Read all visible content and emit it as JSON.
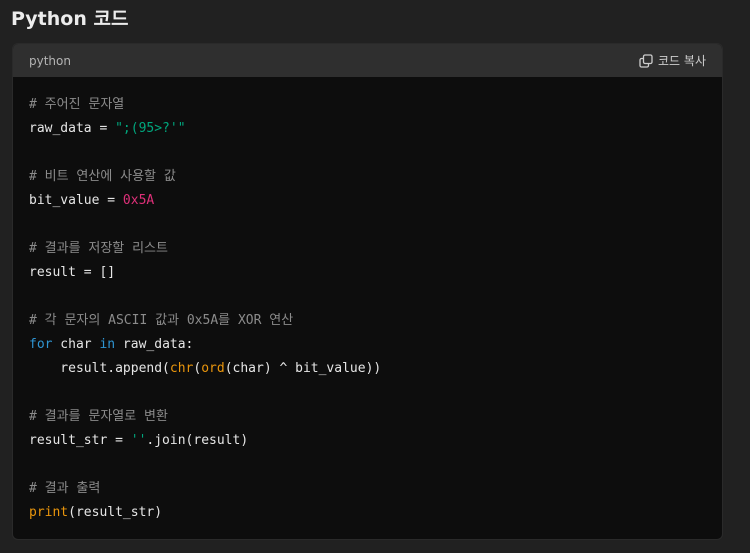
{
  "heading": "Python 코드",
  "code_block": {
    "language": "python",
    "copy_label": "코드 복사",
    "lines": [
      [
        {
          "t": "comment",
          "v": "# 주어진 문자열"
        }
      ],
      [
        {
          "t": "plain",
          "v": "raw_data = "
        },
        {
          "t": "string",
          "v": "\";(95>?'\""
        }
      ],
      [],
      [
        {
          "t": "comment",
          "v": "# 비트 연산에 사용할 값"
        }
      ],
      [
        {
          "t": "plain",
          "v": "bit_value = "
        },
        {
          "t": "number",
          "v": "0x5A"
        }
      ],
      [],
      [
        {
          "t": "comment",
          "v": "# 결과를 저장할 리스트"
        }
      ],
      [
        {
          "t": "plain",
          "v": "result = []"
        }
      ],
      [],
      [
        {
          "t": "comment",
          "v": "# 각 문자의 ASCII 값과 0x5A를 XOR 연산"
        }
      ],
      [
        {
          "t": "keyword",
          "v": "for"
        },
        {
          "t": "plain",
          "v": " char "
        },
        {
          "t": "keyword",
          "v": "in"
        },
        {
          "t": "plain",
          "v": " raw_data:"
        }
      ],
      [
        {
          "t": "plain",
          "v": "    result.append("
        },
        {
          "t": "builtin",
          "v": "chr"
        },
        {
          "t": "plain",
          "v": "("
        },
        {
          "t": "builtin",
          "v": "ord"
        },
        {
          "t": "plain",
          "v": "(char) ^ bit_value))"
        }
      ],
      [],
      [
        {
          "t": "comment",
          "v": "# 결과를 문자열로 변환"
        }
      ],
      [
        {
          "t": "plain",
          "v": "result_str = "
        },
        {
          "t": "string",
          "v": "''"
        },
        {
          "t": "plain",
          "v": ".join(result)"
        }
      ],
      [],
      [
        {
          "t": "comment",
          "v": "# 결과 출력"
        }
      ],
      [
        {
          "t": "builtin",
          "v": "print"
        },
        {
          "t": "plain",
          "v": "(result_str)"
        }
      ]
    ]
  },
  "colors": {
    "background": "#212121",
    "code_background": "#0d0d0d",
    "header_background": "#2f2f2f",
    "comment": "#8b8b8b",
    "string": "#00a67d",
    "number": "#df3079",
    "keyword": "#2e95d3",
    "builtin": "#e9950c"
  },
  "icons": {
    "copy": "copy-icon"
  }
}
